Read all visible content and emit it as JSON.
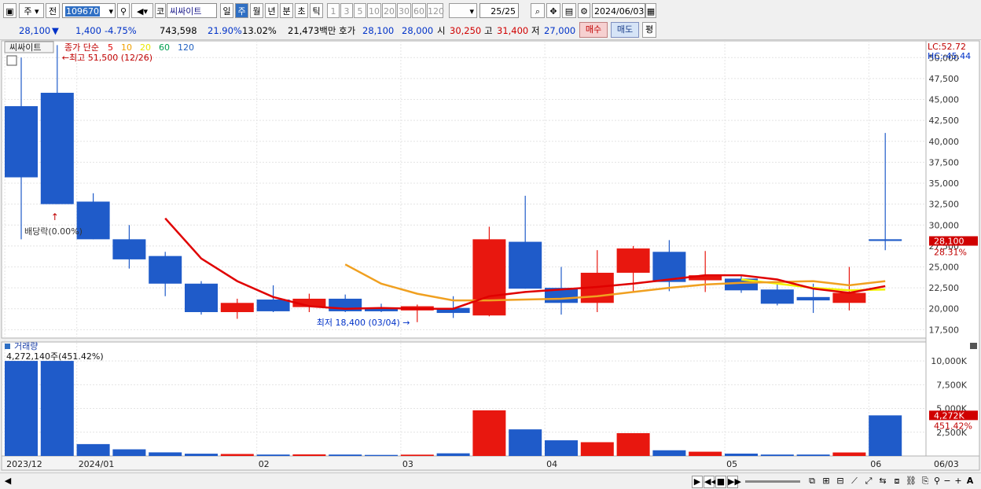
{
  "toolbar": {
    "period_type": "주",
    "prev_label": "전",
    "code": "109670",
    "market_label": "코",
    "stock_name": "씨싸이트",
    "periods": [
      "일",
      "주",
      "월",
      "년",
      "분",
      "초",
      "틱"
    ],
    "active_period": "주",
    "intervals": [
      "1",
      "3",
      "5",
      "10",
      "20",
      "30",
      "60",
      "120"
    ],
    "count": "25/25",
    "date": "2024/06/03"
  },
  "quote": {
    "price": "28,100",
    "change": "1,400",
    "change_pct": "-4.75%",
    "volume": "743,598",
    "turnover_pct": "21.90%",
    "vol_ratio": "13.02%",
    "amount": "21,473백만",
    "quote_label": "호가",
    "ask": "28,100",
    "bid": "28,000",
    "open_label": "시",
    "open": "30,250",
    "high_label": "고",
    "high": "31,400",
    "low_label": "저",
    "low": "27,000",
    "buy_label": "매수",
    "sell_label": "매도",
    "avg_label": "평"
  },
  "chart_data": {
    "type": "candlestick",
    "period": "weekly",
    "stock": "씨싸이트",
    "legend": {
      "name_tag": "씨싸이트",
      "label": "종가 단순",
      "ma_periods": [
        "5",
        "10",
        "20",
        "60",
        "120"
      ],
      "ma_colors": [
        "#e00000",
        "#f0a000",
        "#e8e800",
        "#00a050",
        "#2060c0"
      ]
    },
    "indicators": {
      "lc": "LC:52.72",
      "hc": "HC:-45.44"
    },
    "y_ticks": [
      "50,000",
      "47,500",
      "45,000",
      "42,500",
      "40,000",
      "37,500",
      "35,000",
      "32,500",
      "30,000",
      "27,500",
      "25,000",
      "22,500",
      "20,000",
      "17,500"
    ],
    "ylim": [
      16500,
      52000
    ],
    "candles": [
      {
        "date": "2023/12/18",
        "open": 44200,
        "high": 50000,
        "low": 28300,
        "close": 35700,
        "vol": 10000000
      },
      {
        "date": "2023/12/26",
        "open": 45800,
        "high": 51500,
        "low": 32500,
        "close": 32500,
        "vol": 10000000
      },
      {
        "date": "2024/01/02",
        "open": 32800,
        "high": 33800,
        "low": 28300,
        "close": 28300,
        "vol": 1250000
      },
      {
        "date": "2024/01/08",
        "open": 28300,
        "high": 30000,
        "low": 24800,
        "close": 25900,
        "vol": 700000
      },
      {
        "date": "2024/01/15",
        "open": 26300,
        "high": 26800,
        "low": 21500,
        "close": 23000,
        "vol": 380000
      },
      {
        "date": "2024/01/22",
        "open": 23000,
        "high": 23300,
        "low": 19300,
        "close": 19600,
        "vol": 240000
      },
      {
        "date": "2024/01/29",
        "open": 19600,
        "high": 21200,
        "low": 18800,
        "close": 20700,
        "vol": 210000
      },
      {
        "date": "2024/02/05",
        "open": 21100,
        "high": 22800,
        "low": 19600,
        "close": 19700,
        "vol": 150000
      },
      {
        "date": "2024/02/13",
        "open": 20200,
        "high": 21800,
        "low": 19600,
        "close": 21200,
        "vol": 170000
      },
      {
        "date": "2024/02/19",
        "open": 21200,
        "high": 21700,
        "low": 19600,
        "close": 19700,
        "vol": 150000
      },
      {
        "date": "2024/02/26",
        "open": 20100,
        "high": 20600,
        "low": 19600,
        "close": 19700,
        "vol": 110000
      },
      {
        "date": "2024/03/04",
        "open": 19800,
        "high": 20500,
        "low": 18400,
        "close": 20300,
        "vol": 140000
      },
      {
        "date": "2024/03/11",
        "open": 20100,
        "high": 21500,
        "low": 18900,
        "close": 19500,
        "vol": 280000
      },
      {
        "date": "2024/03/18",
        "open": 19200,
        "high": 29800,
        "low": 19100,
        "close": 28300,
        "vol": 4800000
      },
      {
        "date": "2024/03/25",
        "open": 28000,
        "high": 33500,
        "low": 22400,
        "close": 22400,
        "vol": 2800000
      },
      {
        "date": "2024/04/01",
        "open": 22500,
        "high": 25000,
        "low": 19300,
        "close": 20700,
        "vol": 1650000
      },
      {
        "date": "2024/04/08",
        "open": 20700,
        "high": 27000,
        "low": 19600,
        "close": 24300,
        "vol": 1450000
      },
      {
        "date": "2024/04/15",
        "open": 24300,
        "high": 27500,
        "low": 22100,
        "close": 27200,
        "vol": 2400000
      },
      {
        "date": "2024/04/22",
        "open": 26800,
        "high": 28200,
        "low": 22100,
        "close": 23200,
        "vol": 600000
      },
      {
        "date": "2024/04/29",
        "open": 23400,
        "high": 26900,
        "low": 22000,
        "close": 24000,
        "vol": 450000
      },
      {
        "date": "2024/05/06",
        "open": 23600,
        "high": 24000,
        "low": 21900,
        "close": 22200,
        "vol": 250000
      },
      {
        "date": "2024/05/13",
        "open": 22300,
        "high": 22900,
        "low": 20400,
        "close": 20600,
        "vol": 150000
      },
      {
        "date": "2024/05/20",
        "open": 21400,
        "high": 23000,
        "low": 19500,
        "close": 21000,
        "vol": 150000
      },
      {
        "date": "2024/05/27",
        "open": 20700,
        "high": 25000,
        "low": 19800,
        "close": 21900,
        "vol": 370000
      },
      {
        "date": "2024/06/03",
        "open": 28300,
        "high": 41000,
        "low": 27000,
        "close": 28100,
        "vol": 4272000
      }
    ],
    "ma5": [
      null,
      null,
      null,
      null,
      30800,
      26000,
      23300,
      21400,
      20300,
      20000,
      20100,
      20000,
      20000,
      21500,
      22000,
      22300,
      22600,
      23000,
      23500,
      24000,
      24000,
      23500,
      22400,
      21900,
      22700
    ],
    "ma10": [
      null,
      null,
      null,
      null,
      null,
      null,
      null,
      null,
      null,
      25300,
      23000,
      21800,
      21000,
      21000,
      21100,
      21200,
      21500,
      22000,
      22500,
      22900,
      23100,
      23200,
      23300,
      22800,
      23300
    ],
    "ma20": [
      null,
      null,
      null,
      null,
      null,
      null,
      null,
      null,
      null,
      null,
      null,
      null,
      null,
      null,
      null,
      null,
      null,
      null,
      null,
      null,
      23500,
      23000,
      22500,
      22200,
      22300
    ],
    "annotations": {
      "high": "최고 51,500 (12/26)",
      "low": "최저 18,400 (03/04)",
      "dividend": "배당락(0.00%)"
    },
    "last_price_label": "28,100",
    "last_pct_label": "28.31%",
    "volume_panel": {
      "title": "거래량",
      "summary": "4,272,140주(451.42%)",
      "y_ticks": [
        "10,000K",
        "7,500K",
        "5,000K",
        "2,500K"
      ],
      "ymax": 11000000,
      "last_label": "4,272K",
      "last_pct": "451.42%"
    },
    "x_labels": [
      {
        "i": 0,
        "text": "2023/12"
      },
      {
        "i": 2,
        "text": "2024/01"
      },
      {
        "i": 7,
        "text": "02"
      },
      {
        "i": 11,
        "text": "03"
      },
      {
        "i": 15,
        "text": "04"
      },
      {
        "i": 20,
        "text": "05"
      },
      {
        "i": 24,
        "text": "06"
      }
    ],
    "x_end_label": "06/03",
    "colors": {
      "up": "#e8170f",
      "down": "#1f5bc9",
      "ma5": "#e00000",
      "ma10": "#f0a020",
      "ma20": "#f2f200"
    }
  }
}
